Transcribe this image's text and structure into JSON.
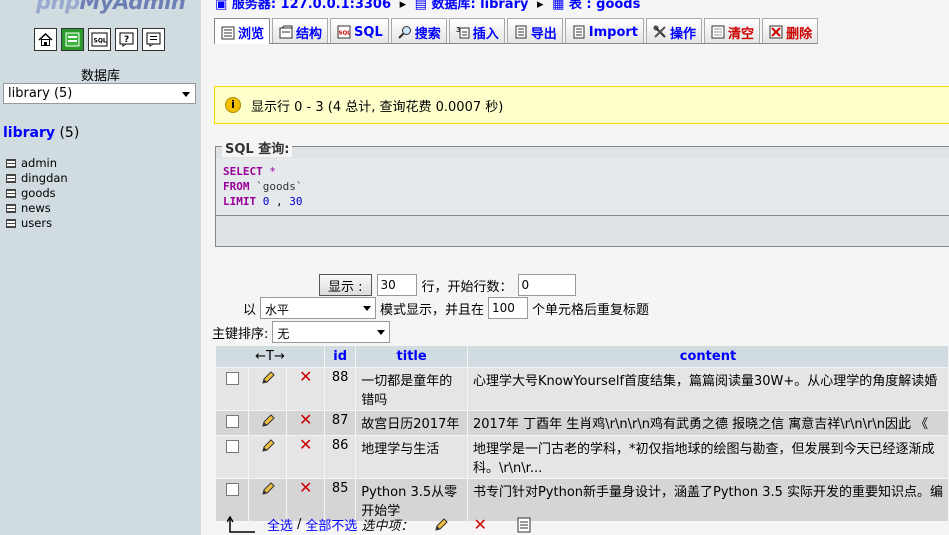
{
  "nav": {
    "logo_part1": "php",
    "logo_part2": "MyAdmin",
    "icons": [
      "home-icon",
      "sql-window-icon",
      "sql-doc-icon",
      "help-icon",
      "docs-icon"
    ],
    "db_label": "数据库",
    "db_select_value": "library (5)",
    "db_name": "library",
    "db_count": "(5)",
    "tables": [
      "admin",
      "dingdan",
      "goods",
      "news",
      "users"
    ]
  },
  "breadcrumb": {
    "server": "服务器: 127.0.0.1:3306",
    "database": "数据库: library",
    "table": "表 : goods"
  },
  "tabs": [
    {
      "label": "浏览",
      "icon": "browse-icon"
    },
    {
      "label": "结构",
      "icon": "structure-icon"
    },
    {
      "label": "SQL",
      "icon": "sql-icon"
    },
    {
      "label": "搜索",
      "icon": "search-icon"
    },
    {
      "label": "插入",
      "icon": "insert-icon"
    },
    {
      "label": "导出",
      "icon": "export-icon"
    },
    {
      "label": "Import",
      "icon": "import-icon"
    },
    {
      "label": "操作",
      "icon": "operations-icon"
    },
    {
      "label": "清空",
      "icon": "empty-icon"
    },
    {
      "label": "删除",
      "icon": "drop-icon"
    }
  ],
  "notice": "显示行 0 - 3 (4 总计, 查询花费 0.0007 秒)",
  "sql": {
    "title": "SQL 查询:",
    "select": "SELECT",
    "star": " *",
    "from": "FROM",
    "table": " `goods`",
    "limit": "LIMIT",
    "offset": " 0",
    "comma": " ,",
    "count": " 30"
  },
  "controls": {
    "show_button": "显示 :",
    "rows_value": "30",
    "rows_label": "行，开始行数：",
    "start_value": "0",
    "mode_prefix": "以",
    "mode_value": "水平",
    "mode_label": "模式显示，并且在",
    "repeat_value": "100",
    "repeat_label": "个单元格后重复标题",
    "sort_label": "主键排序:",
    "sort_value": "无"
  },
  "grid": {
    "headers": {
      "arrows": "←T→",
      "id": "id",
      "title": "title",
      "content": "content"
    },
    "rows": [
      {
        "id": "88",
        "title": "一切都是童年的错吗",
        "content": "心理学大号KnowYourself首度结集，篇篇阅读量30W+。从心理学的角度解读婚"
      },
      {
        "id": "87",
        "title": "故宫日历2017年",
        "content": "2017年 丁酉年 生肖鸡\\r\\n\\r\\n鸡有武勇之德 报晓之信 寓意吉祥\\r\\n\\r\\n因此 《"
      },
      {
        "id": "86",
        "title": "地理学与生活",
        "content": "地理学是一门古老的学科，*初仅指地球的绘图与勘查，但发展到今天已经逐渐成",
        "content2": "科。\\r\\n\\r..."
      },
      {
        "id": "85",
        "title": "Python 3.5从零开始学",
        "content": "书专门针对Python新手量身设计，涵盖了Python 3.5 实际开发的重要知识点。编"
      }
    ]
  },
  "footer": {
    "check_all": "全选",
    "slash": "/",
    "uncheck_all": "全部不选",
    "with_selected": "选中项："
  }
}
